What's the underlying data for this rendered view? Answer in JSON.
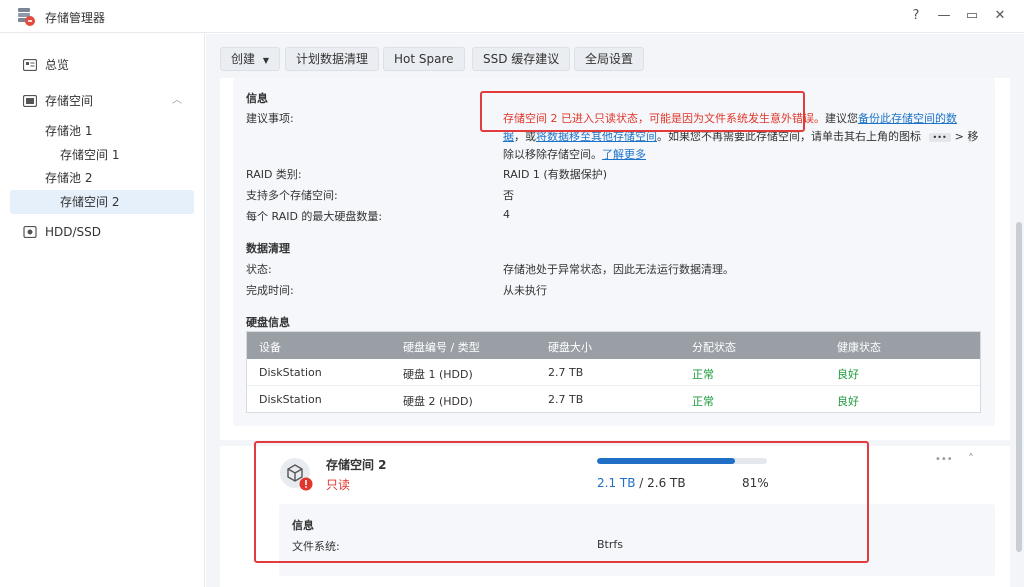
{
  "app": {
    "title": "存储管理器"
  },
  "window": {
    "help": "?",
    "minimize": "—",
    "maximize": "▭",
    "close": "✕"
  },
  "sidebar": {
    "items": [
      {
        "label": "总览"
      },
      {
        "label": "存储空间"
      },
      {
        "label": "存储池 1"
      },
      {
        "label": "存储空间 1"
      },
      {
        "label": "存储池 2"
      },
      {
        "label": "存储空间 2"
      },
      {
        "label": "HDD/SSD"
      }
    ]
  },
  "toolbar": {
    "create": "创建",
    "scrub": "计划数据清理",
    "hotspare": "Hot Spare",
    "ssd": "SSD 缓存建议",
    "global": "全局设置"
  },
  "pool_info": {
    "section_title": "信息",
    "advice_label": "建议事项:",
    "advice_line1_warn": "存储空间 2 已进入只读状态，可能是因为文件系统发生意外错误。",
    "advice_line1_rest": "建议您",
    "advice_line1_link": "备份此存储空间的数",
    "advice_line2_link1": "据",
    "advice_line2_a": "，或",
    "advice_line2_link2": "将数据移至其他存储空间",
    "advice_line2_b": "。如果您不再需要此存储空间，请单击其右上角的图标",
    "advice_line2_icon": "•••",
    "advice_line2_c": "> 移",
    "advice_line3_a": "除以移除存储空间。",
    "advice_line3_link": "了解更多",
    "raid_label": "RAID 类别:",
    "raid_value": "RAID 1 (有数据保护)",
    "multi_label": "支持多个存储空间:",
    "multi_value": "否",
    "max_label": "每个 RAID 的最大硬盘数量:",
    "max_value": "4"
  },
  "scrubbing": {
    "title": "数据清理",
    "status_label": "状态:",
    "status_value": "存储池处于异常状态，因此无法运行数据清理。",
    "time_label": "完成时间:",
    "time_value": "从未执行"
  },
  "disk_info": {
    "title": "硬盘信息",
    "columns": [
      "设备",
      "硬盘编号 / 类型",
      "硬盘大小",
      "分配状态",
      "健康状态"
    ],
    "rows": [
      {
        "device": "DiskStation",
        "disk": "硬盘 1 (HDD)",
        "size": "2.7 TB",
        "alloc": "正常",
        "health": "良好"
      },
      {
        "device": "DiskStation",
        "disk": "硬盘 2 (HDD)",
        "size": "2.7 TB",
        "alloc": "正常",
        "health": "良好"
      }
    ]
  },
  "volume": {
    "name": "存储空间 2",
    "status": "只读",
    "used": "2.1 TB",
    "separator": " / ",
    "total": "2.6 TB",
    "percent_text": "81%",
    "usage_fraction": 0.81,
    "more_icon": "•••",
    "collapse_icon": "˄",
    "info_title": "信息",
    "fs_label": "文件系统:",
    "fs_value": "Btrfs"
  },
  "colors": {
    "accent": "#1f6fc6",
    "warning": "#e0362b",
    "success": "#1d9a3d",
    "highlight": "#e23b3b"
  }
}
